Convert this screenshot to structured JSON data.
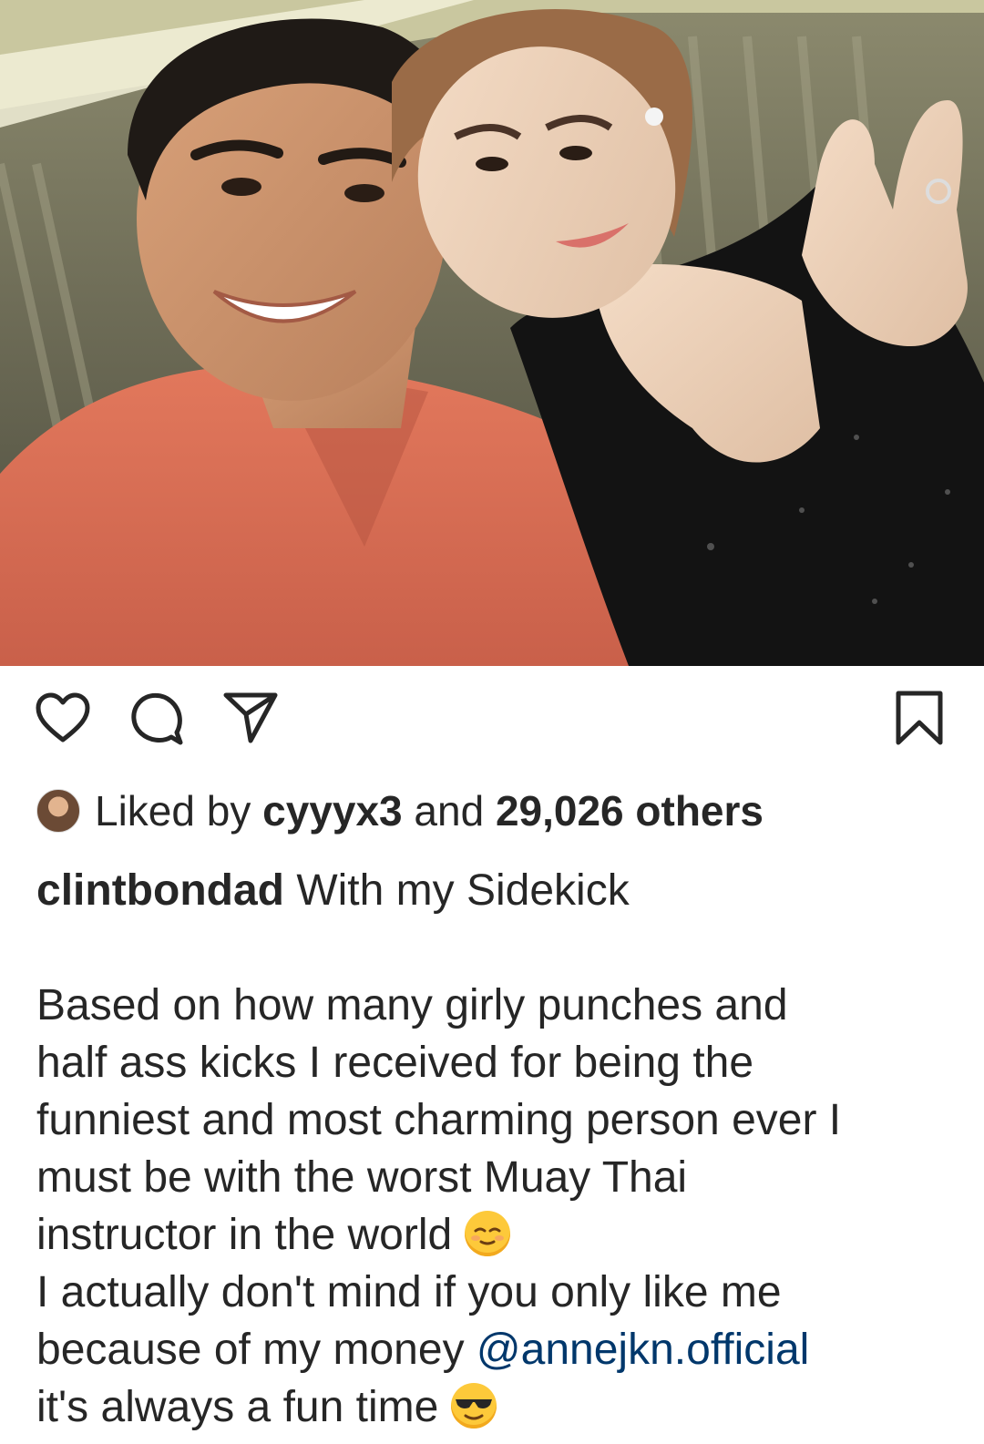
{
  "post": {
    "likes": {
      "prefix": "Liked by",
      "user": "cyyyx3",
      "middle": "and",
      "count": "29,026 others"
    },
    "caption": {
      "username": "clintbondad",
      "title": "With my Sidekick",
      "lines": [
        "Based on how many girly punches and",
        "half ass kicks I received for being the",
        "funniest and most charming person ever I",
        "must be with the worst Muay Thai",
        "instructor in the world",
        "I actually don't mind if you only like me",
        "because of my money",
        "it's always a fun time"
      ],
      "mention": "@annejkn.official"
    },
    "icons": [
      "heart-icon",
      "comment-icon",
      "share-icon",
      "bookmark-icon",
      "relieved-face-emoji",
      "sunglasses-face-emoji"
    ],
    "colors": {
      "text": "#262626",
      "mention": "#00376b",
      "background": "#ffffff"
    }
  }
}
